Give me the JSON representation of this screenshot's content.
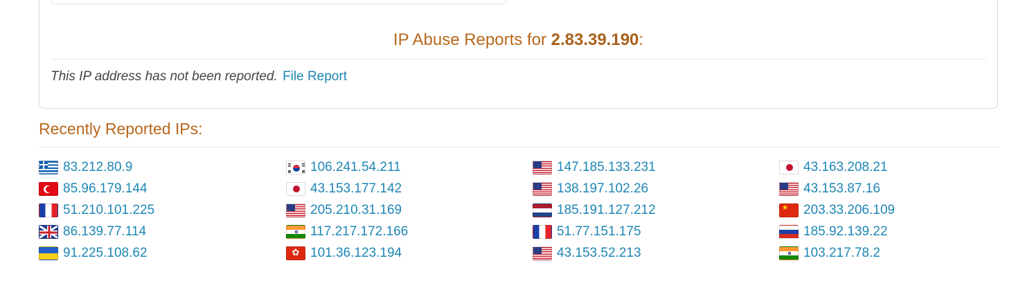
{
  "report": {
    "heading_prefix": "IP Abuse Reports for ",
    "ip": "2.83.39.190",
    "heading_suffix": ":",
    "status_text": "This IP address has not been reported.",
    "file_report_link": "File Report"
  },
  "recent": {
    "heading": "Recently Reported IPs:",
    "columns": [
      [
        {
          "ip": "83.212.80.9",
          "flag": "gr"
        },
        {
          "ip": "85.96.179.144",
          "flag": "tr"
        },
        {
          "ip": "51.210.101.225",
          "flag": "fr"
        },
        {
          "ip": "86.139.77.114",
          "flag": "gb"
        },
        {
          "ip": "91.225.108.62",
          "flag": "ua"
        }
      ],
      [
        {
          "ip": "106.241.54.211",
          "flag": "kr"
        },
        {
          "ip": "43.153.177.142",
          "flag": "jp"
        },
        {
          "ip": "205.210.31.169",
          "flag": "us"
        },
        {
          "ip": "117.217.172.166",
          "flag": "in"
        },
        {
          "ip": "101.36.123.194",
          "flag": "hk"
        }
      ],
      [
        {
          "ip": "147.185.133.231",
          "flag": "us"
        },
        {
          "ip": "138.197.102.26",
          "flag": "us"
        },
        {
          "ip": "185.191.127.212",
          "flag": "nl"
        },
        {
          "ip": "51.77.151.175",
          "flag": "fr"
        },
        {
          "ip": "43.153.52.213",
          "flag": "us"
        }
      ],
      [
        {
          "ip": "43.163.208.21",
          "flag": "jp"
        },
        {
          "ip": "43.153.87.16",
          "flag": "us"
        },
        {
          "ip": "203.33.206.109",
          "flag": "cn"
        },
        {
          "ip": "185.92.139.22",
          "flag": "ru"
        },
        {
          "ip": "103.217.78.2",
          "flag": "in"
        }
      ]
    ]
  },
  "colors": {
    "accent_heading": "#b8671d",
    "link": "#1e86b5",
    "border": "#d8d8d8"
  }
}
